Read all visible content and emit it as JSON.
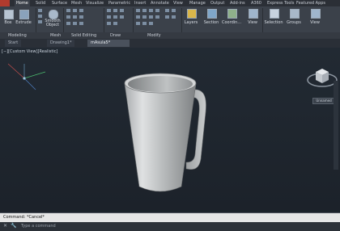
{
  "ribbon": {
    "tabs": [
      "Home",
      "Solid",
      "Surface",
      "Mesh",
      "Visualize",
      "Parametric",
      "Insert",
      "Annotate",
      "View",
      "Manage",
      "Output",
      "Add-ins",
      "A360",
      "Express Tools",
      "Featured Apps"
    ],
    "active_tab": "Home",
    "buttons": {
      "box": "Box",
      "extrude": "Extrude",
      "smooth_object": "Smooth\nObject",
      "layers": "Layers",
      "section": "Section",
      "coordinates": "Coordin...",
      "view": "View",
      "selection": "Selection",
      "groups": "Groups",
      "view2": "View"
    },
    "panels": [
      "Modeling",
      "Mesh",
      "Solid Editing",
      "Draw",
      "Modify"
    ]
  },
  "doc_tabs": [
    "Start",
    "Drawing1*",
    "mAsula5*"
  ],
  "viewport": {
    "label": "[−][Custom View][Realistic]",
    "viewcube_label": "Unnamed"
  },
  "command": {
    "history": "Command: *Cancel*",
    "placeholder": "Type a command"
  }
}
